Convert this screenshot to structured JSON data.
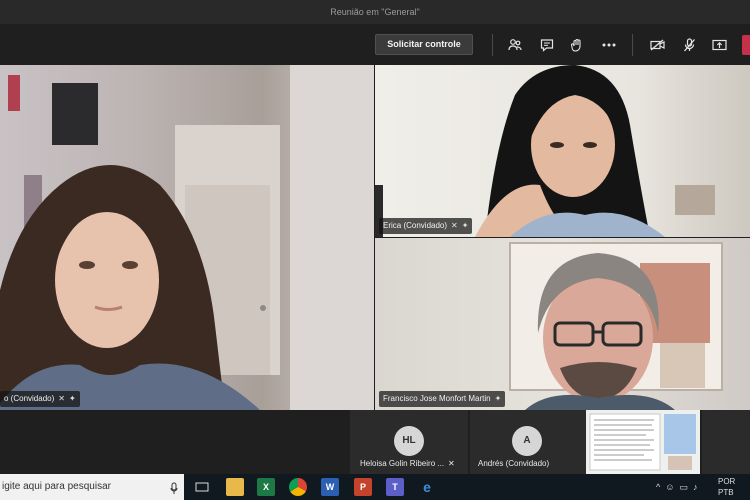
{
  "window": {
    "title": "Reunião em \"General\""
  },
  "toolbar": {
    "request_control_label": "Solicitar controle",
    "icons": [
      "participants-icon",
      "chat-icon",
      "raise-hand-icon",
      "more-icon",
      "camera-off-icon",
      "mic-off-icon",
      "share-icon",
      "hangup-icon"
    ],
    "hangup_color": "#c4314b"
  },
  "participants": {
    "main": {
      "label": "o (Convidado)"
    },
    "erica": {
      "label": "Erica (Convidado)"
    },
    "francisco": {
      "label": "Francisco Jose Monfort Martin"
    }
  },
  "strip": {
    "heloisa": {
      "initials": "HL",
      "name": "Heloisa Golin Ribeiro ..."
    },
    "andres": {
      "initials": "A",
      "name": "Andrés (Convidado)"
    }
  },
  "taskbar": {
    "search_placeholder": "igite aqui para pesquisar",
    "apps": [
      "task-view-icon",
      "file-explorer-icon",
      "excel-icon",
      "chrome-icon",
      "word-icon",
      "powerpoint-icon",
      "teams-icon",
      "edge-icon"
    ],
    "lang_line1": "POR",
    "lang_line2": "PTB"
  }
}
